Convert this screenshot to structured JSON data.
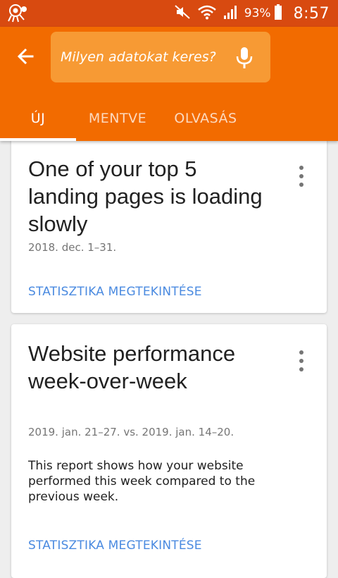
{
  "status_bar": {
    "battery_percent": "93%",
    "time": "8:57",
    "icons": [
      "notification-icon",
      "mute-icon",
      "wifi-icon",
      "signal-icon",
      "battery-icon"
    ]
  },
  "app_bar": {
    "search_placeholder": "Milyen adatokat keres?",
    "search_value": "",
    "back_icon": "arrow-back-icon",
    "mic_icon": "mic-icon"
  },
  "tabs": [
    {
      "label": "ÚJ",
      "active": true
    },
    {
      "label": "MENTVE",
      "active": false
    },
    {
      "label": "OLVASÁS",
      "active": false
    }
  ],
  "cards": [
    {
      "title": "One of your top 5 landing pages is loading slowly",
      "date": "2018. dec. 1–31.",
      "link": "STATISZTIKA MEGTEKINTÉSE"
    },
    {
      "title": "Website performance week-over-week",
      "date": "2019. jan. 21–27. vs. 2019. jan. 14–20.",
      "description": "This report shows how your website performed this week compared to the previous week.",
      "link": "STATISZTIKA MEGTEKINTÉSE"
    }
  ],
  "colors": {
    "status_bar": "#d84a10",
    "app_bar": "#f26b00",
    "search_box": "#f79a34",
    "link": "#4a8ae0"
  }
}
